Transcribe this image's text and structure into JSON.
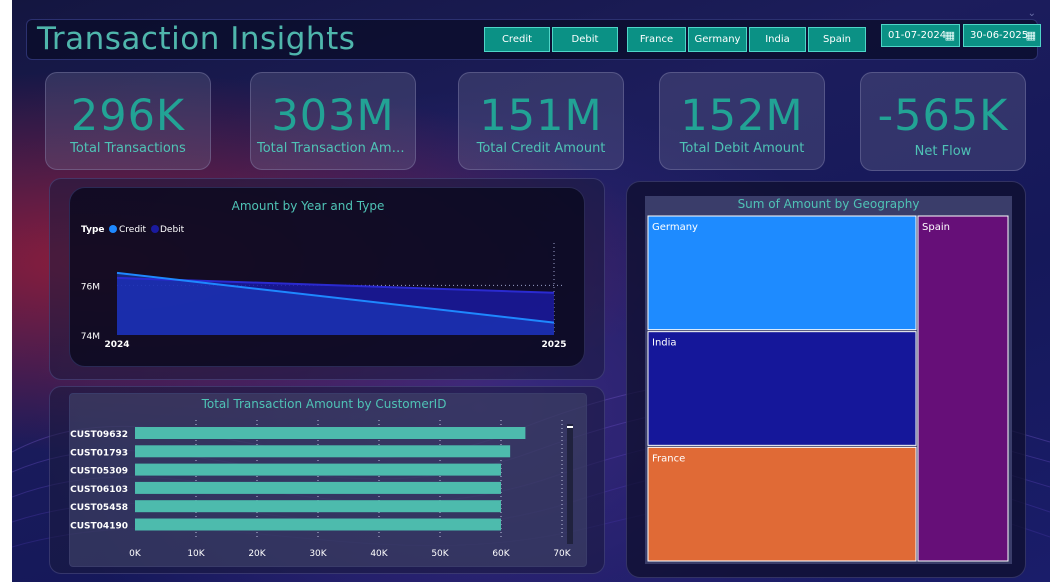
{
  "header": {
    "title": "Transaction Insights",
    "type_slicer": [
      "Credit",
      "Debit"
    ],
    "geo_slicer": [
      "France",
      "Germany",
      "India",
      "Spain"
    ],
    "date_start": "01-07-2024",
    "date_end": "30-06-2025"
  },
  "kpis": [
    {
      "value": "296K",
      "label": "Total Transactions"
    },
    {
      "value": "303M",
      "label": "Total Transaction Amount"
    },
    {
      "value": "151M",
      "label": "Total Credit Amount"
    },
    {
      "value": "152M",
      "label": "Total Debit Amount"
    },
    {
      "value": "-565K",
      "label": "Net Flow"
    }
  ],
  "colors": {
    "credit": "#1e88ff",
    "debit": "#1a1a9e",
    "teal": "#4fb6ac",
    "bar": "#4dbbad",
    "kpi_value": "#22a395"
  },
  "chart_data": [
    {
      "type": "area",
      "title": "Amount by Year and Type",
      "legend_title": "Type",
      "legend_position": "top-left",
      "x": [
        "2024",
        "2025"
      ],
      "y_ticks": [
        "74M",
        "76M"
      ],
      "ylim": [
        74,
        77.1
      ],
      "series": [
        {
          "name": "Credit",
          "values": [
            76.5,
            74.5
          ]
        },
        {
          "name": "Debit",
          "values": [
            76.3,
            75.7
          ]
        }
      ]
    },
    {
      "type": "bar",
      "orientation": "horizontal",
      "title": "Total Transaction Amount by CustomerID",
      "categories": [
        "CUST09632",
        "CUST01793",
        "CUST05309",
        "CUST06103",
        "CUST05458",
        "CUST04190"
      ],
      "values": [
        64000,
        61500,
        60000,
        60000,
        60000,
        60000
      ],
      "x_ticks": [
        "0K",
        "10K",
        "20K",
        "30K",
        "40K",
        "50K",
        "60K",
        "70K"
      ],
      "xlim": [
        0,
        70000
      ]
    },
    {
      "type": "treemap",
      "title": "Sum of Amount by Geography",
      "categories": [
        "Germany",
        "India",
        "France",
        "Spain"
      ],
      "values": [
        76,
        76,
        76,
        76
      ]
    }
  ]
}
